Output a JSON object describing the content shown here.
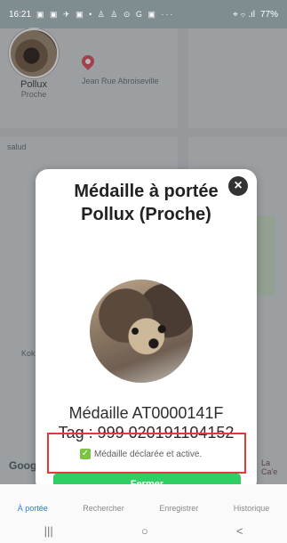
{
  "status_bar": {
    "time": "16:21",
    "icons": "▣ ▣ ✈ ▣ • ♙ ♙ ⊙ G ▣ ···",
    "signal": "⌖ ⌔ .ıl",
    "battery": "77%"
  },
  "map": {
    "pet_name": "Pollux",
    "pet_proximity": "Proche",
    "label_salud": "salud",
    "label_kok": "Kok",
    "label_street": "Jean Rue Abroiseville",
    "google": "Google",
    "right_label": "La Ca'e"
  },
  "modal": {
    "title_line1": "Médaille à portée",
    "title_line2": "Pollux (Proche)",
    "close": "×",
    "medal": "Médaille AT0000141F",
    "tag": "Tag : 999 020191104152",
    "status": "Médaille déclarée et active.",
    "close_button": "Fermer"
  },
  "tabs": [
    {
      "label": "À portée",
      "active": true
    },
    {
      "label": "Rechercher",
      "active": false
    },
    {
      "label": "Enregistrer",
      "active": false
    },
    {
      "label": "Historique",
      "active": false
    }
  ],
  "nav": {
    "recent": "|||",
    "home": "○",
    "back": "<"
  }
}
